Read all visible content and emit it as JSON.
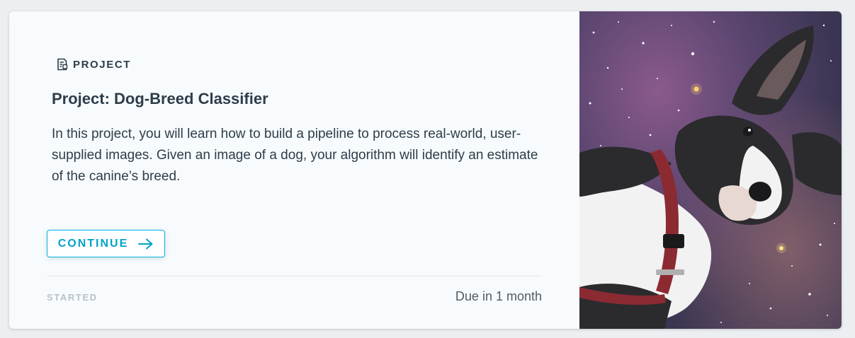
{
  "card": {
    "eyebrow": "PROJECT",
    "title": "Project: Dog-Breed Classifier",
    "description": "In this project, you will learn how to build a pipeline to process real-world, user-supplied images. Given an image of a dog, your algorithm will identify an estimate of the canine’s breed.",
    "continue_label": "CONTINUE",
    "status": "STARTED",
    "due": "Due in 1 month",
    "image_icon": "dog-in-space-photo"
  },
  "colors": {
    "accent": "#02b3e4",
    "text": "#2e3d49",
    "muted": "#b7c2c9",
    "card_bg": "#f7fbfd"
  }
}
